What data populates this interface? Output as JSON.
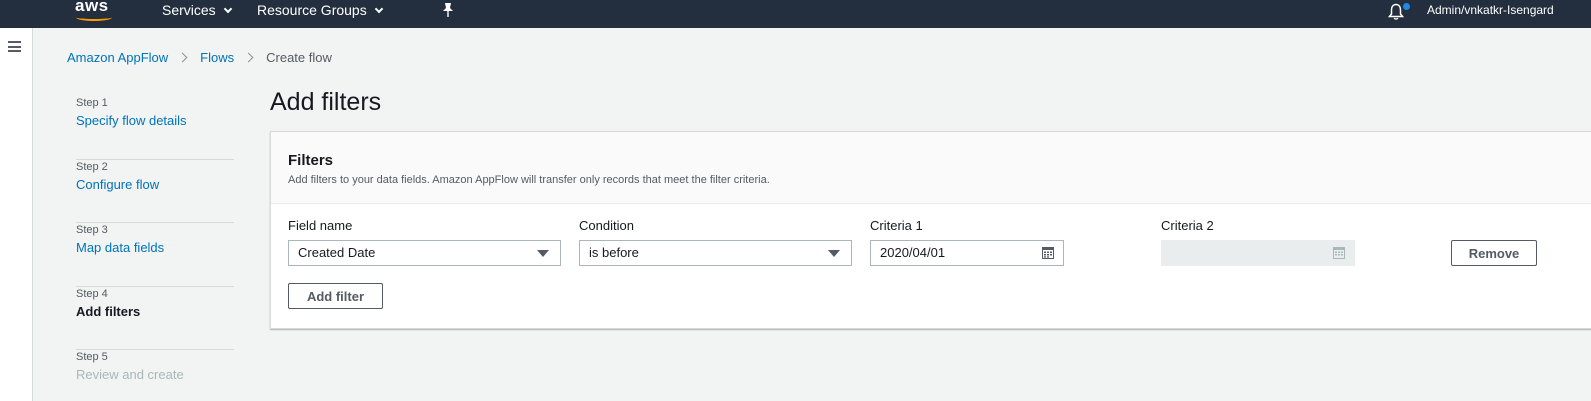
{
  "topnav": {
    "logo": "aws",
    "services_label": "Services",
    "resource_groups_label": "Resource Groups",
    "account_label": "Admin/vnkatkr-Isengard"
  },
  "breadcrumb": {
    "items": [
      "Amazon AppFlow",
      "Flows"
    ],
    "current": "Create flow"
  },
  "steps": [
    {
      "number": "Step 1",
      "title": "Specify flow details",
      "state": "link"
    },
    {
      "number": "Step 2",
      "title": "Configure flow",
      "state": "link"
    },
    {
      "number": "Step 3",
      "title": "Map data fields",
      "state": "link"
    },
    {
      "number": "Step 4",
      "title": "Add filters",
      "state": "current"
    },
    {
      "number": "Step 5",
      "title": "Review and create",
      "state": "disabled"
    }
  ],
  "page": {
    "title": "Add filters"
  },
  "filters_panel": {
    "title": "Filters",
    "description": "Add filters to your data fields. Amazon AppFlow will transfer only records that meet the filter criteria.",
    "labels": {
      "field_name": "Field name",
      "condition": "Condition",
      "criteria1": "Criteria 1",
      "criteria2": "Criteria 2"
    },
    "row": {
      "field_name_value": "Created Date",
      "condition_value": "is before",
      "criteria1_value": "2020/04/01",
      "criteria2_value": ""
    },
    "remove_label": "Remove",
    "add_filter_label": "Add filter"
  },
  "colors": {
    "nav_bg": "#232f3e",
    "link": "#0073bb",
    "accent": "#ff9900"
  }
}
